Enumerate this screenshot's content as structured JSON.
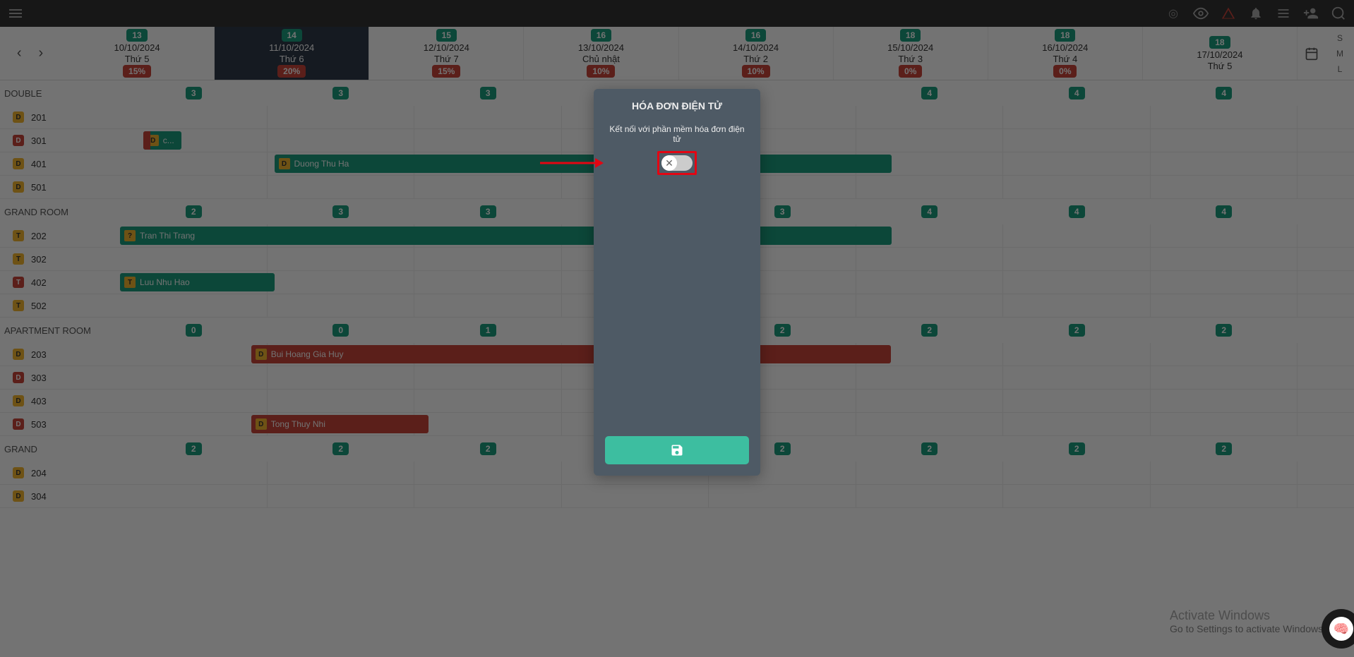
{
  "sizeLabels": [
    "S",
    "M",
    "L"
  ],
  "days": [
    {
      "count": "13",
      "date": "10/10/2024",
      "dow": "Thứ 5",
      "pct": "15%",
      "selected": false
    },
    {
      "count": "14",
      "date": "11/10/2024",
      "dow": "Thứ 6",
      "pct": "20%",
      "selected": true
    },
    {
      "count": "15",
      "date": "12/10/2024",
      "dow": "Thứ 7",
      "pct": "15%",
      "selected": false
    },
    {
      "count": "16",
      "date": "13/10/2024",
      "dow": "Chủ nhật",
      "pct": "10%",
      "selected": false
    },
    {
      "count": "16",
      "date": "14/10/2024",
      "dow": "Thứ 2",
      "pct": "10%",
      "selected": false
    },
    {
      "count": "18",
      "date": "15/10/2024",
      "dow": "Thứ 3",
      "pct": "0%",
      "selected": false
    },
    {
      "count": "18",
      "date": "16/10/2024",
      "dow": "Thứ 4",
      "pct": "0%",
      "selected": false
    },
    {
      "count": "18",
      "date": "17/10/2024",
      "dow": "Thứ 5",
      "pct": "",
      "selected": false
    }
  ],
  "sections": [
    {
      "name": "DOUBLE",
      "counts": [
        "3",
        "3",
        "3",
        "",
        "",
        "4",
        "4",
        "4"
      ],
      "rooms": [
        {
          "num": "201",
          "icon": "D",
          "iconRed": false,
          "bookings": []
        },
        {
          "num": "301",
          "icon": "D",
          "iconRed": true,
          "bookings": [
            {
              "name": "c...",
              "start": 0.15,
              "end": 0.4,
              "tag": "D",
              "cls": "bk-green",
              "leftCls": "bk-red"
            }
          ]
        },
        {
          "num": "401",
          "icon": "D",
          "iconRed": false,
          "bookings": [
            {
              "name": "Duong Thu Ha",
              "start": 1.0,
              "end": 5.0,
              "tag": "D",
              "cls": "bk-green"
            }
          ]
        },
        {
          "num": "501",
          "icon": "D",
          "iconRed": false,
          "bookings": []
        }
      ]
    },
    {
      "name": "GRAND ROOM",
      "counts": [
        "2",
        "3",
        "3",
        "",
        "3",
        "4",
        "4",
        "4"
      ],
      "rooms": [
        {
          "num": "202",
          "icon": "T",
          "iconRed": false,
          "bookings": [
            {
              "name": "Tran Thi Trang",
              "start": 0.0,
              "end": 5.0,
              "tag": "?",
              "cls": "bk-green"
            }
          ]
        },
        {
          "num": "302",
          "icon": "T",
          "iconRed": false,
          "bookings": []
        },
        {
          "num": "402",
          "icon": "T",
          "iconRed": true,
          "bookings": [
            {
              "name": "Luu Nhu Hao",
              "start": 0.0,
              "end": 1.0,
              "tag": "T",
              "cls": "bk-green"
            }
          ]
        },
        {
          "num": "502",
          "icon": "T",
          "iconRed": false,
          "bookings": []
        }
      ]
    },
    {
      "name": "APARTMENT ROOM",
      "counts": [
        "0",
        "0",
        "1",
        "",
        "2",
        "2",
        "2",
        "2"
      ],
      "rooms": [
        {
          "num": "203",
          "icon": "D",
          "iconRed": false,
          "bookings": [
            {
              "name": "Bui Hoang Gia Huy",
              "start": 0.85,
              "end": 5.0,
              "tag": "D",
              "cls": "bk-red"
            }
          ]
        },
        {
          "num": "303",
          "icon": "D",
          "iconRed": true,
          "bookings": []
        },
        {
          "num": "403",
          "icon": "D",
          "iconRed": false,
          "bookings": []
        },
        {
          "num": "503",
          "icon": "D",
          "iconRed": true,
          "bookings": [
            {
              "name": "Tong Thuy Nhi",
              "start": 0.85,
              "end": 2.0,
              "tag": "D",
              "cls": "bk-red"
            }
          ]
        }
      ]
    },
    {
      "name": "GRAND",
      "counts": [
        "2",
        "2",
        "2",
        "",
        "2",
        "2",
        "2",
        "2"
      ],
      "rooms": [
        {
          "num": "204",
          "icon": "D",
          "iconRed": false,
          "bookings": []
        },
        {
          "num": "304",
          "icon": "D",
          "iconRed": false,
          "bookings": []
        }
      ]
    }
  ],
  "modal": {
    "title": "HÓA ĐƠN ĐIỆN TỬ",
    "desc": "Kết nối với phần mềm hóa đơn điện tử",
    "toggleOn": false
  },
  "watermark": {
    "big": "Activate Windows",
    "small": "Go to Settings to activate Windows."
  }
}
